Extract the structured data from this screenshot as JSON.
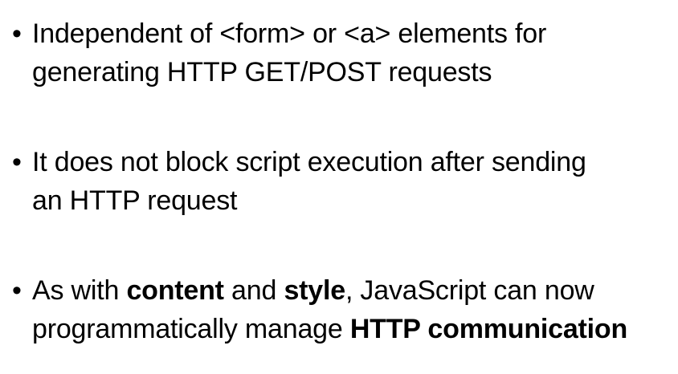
{
  "bullet_glyph": "•",
  "bullets": [
    {
      "line1": "Independent of <form> or <a> elements for",
      "line2": "generating HTTP GET/POST requests"
    },
    {
      "line1": "It does not block script execution after sending",
      "line2": "an HTTP request"
    },
    {
      "line1_a": "As with ",
      "line1_b": "content",
      "line1_c": " and ",
      "line1_d": "style",
      "line1_e": ", JavaScript can now",
      "line2_a": "programmatically manage ",
      "line2_b": "HTTP communication"
    }
  ]
}
